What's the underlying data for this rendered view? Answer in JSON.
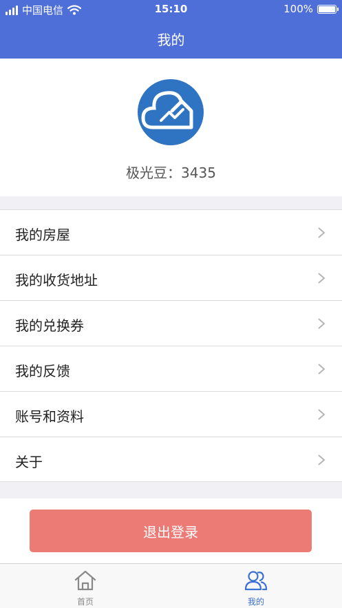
{
  "status_bar": {
    "carrier": "中国电信",
    "time": "15:10",
    "battery": "100%"
  },
  "nav": {
    "title": "我的"
  },
  "profile": {
    "points_text": "极光豆：3435"
  },
  "menu": {
    "items": [
      {
        "label": "我的房屋"
      },
      {
        "label": "我的收货地址"
      },
      {
        "label": "我的兑换券"
      },
      {
        "label": "我的反馈"
      },
      {
        "label": "账号和资料"
      },
      {
        "label": "关于"
      }
    ]
  },
  "logout": {
    "label": "退出登录"
  },
  "tabbar": {
    "tabs": [
      {
        "label": "首页",
        "active": false
      },
      {
        "label": "我的",
        "active": true
      }
    ]
  },
  "colors": {
    "header": "#4f6fd8",
    "logout_button": "#ec7a75",
    "active_tab": "#3b6fd6",
    "avatar": "#2f74c2"
  }
}
